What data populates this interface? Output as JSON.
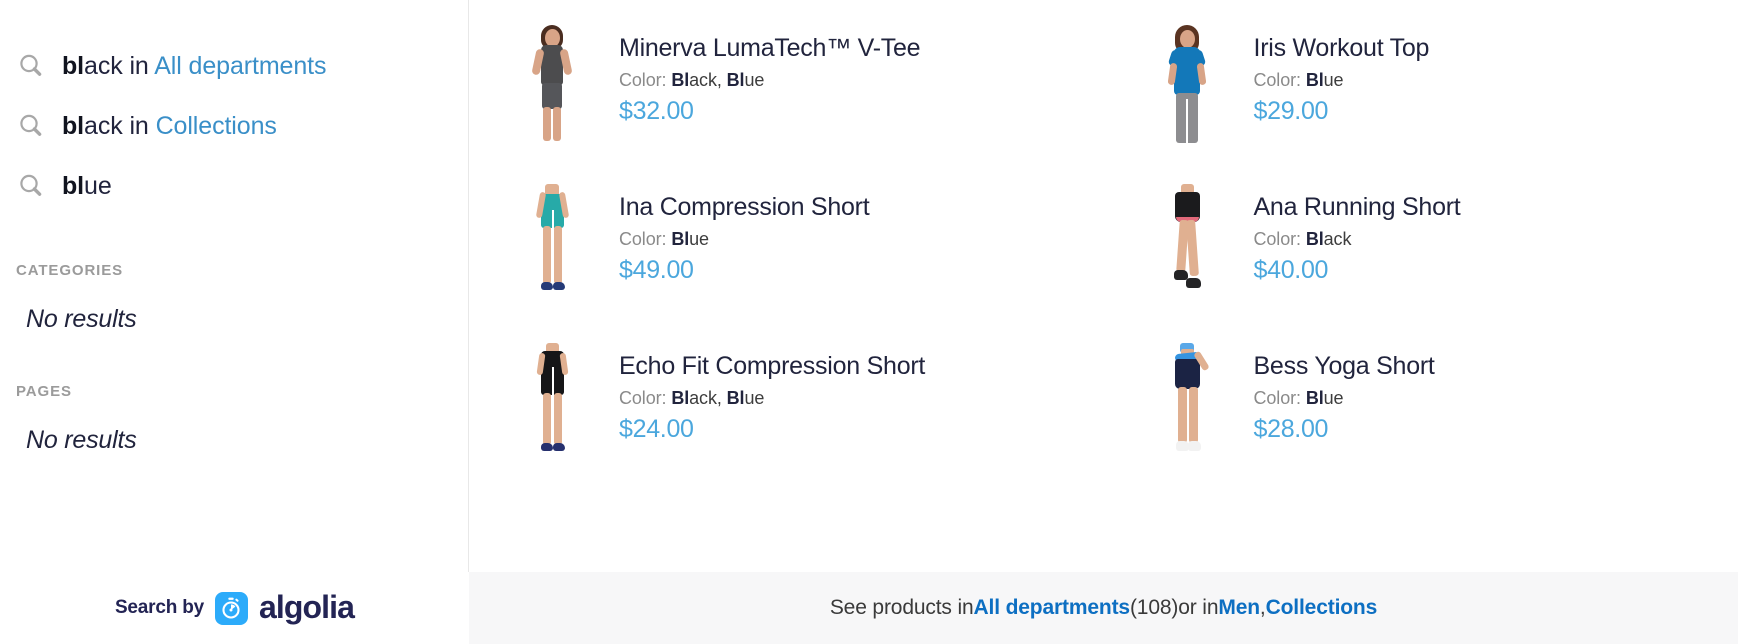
{
  "left": {
    "suggestions": [
      {
        "icon": "search-icon",
        "bold": "bl",
        "rest": "ack in ",
        "scope": "All departments"
      },
      {
        "icon": "search-icon",
        "bold": "bl",
        "rest": "ack in ",
        "scope": "Collections"
      },
      {
        "icon": "search-icon",
        "bold": "bl",
        "rest": "ue",
        "scope": ""
      }
    ],
    "categories": {
      "heading": "CATEGORIES",
      "empty_text": "No results"
    },
    "pages": {
      "heading": "PAGES",
      "empty_text": "No results"
    },
    "branding": {
      "prefix": "Search by",
      "name": "algolia",
      "mark_icon": "algolia-stopwatch-icon",
      "mark_color": "#2cabfa",
      "text_color": "#232454"
    }
  },
  "products": [
    {
      "title": "Minerva LumaTech™ V-Tee",
      "color_label": "Color:",
      "color_bold": "Bl",
      "color_rest": "ack, ",
      "color_bold2": "Bl",
      "color_rest2": "ue",
      "price": "$32.00",
      "image": "woman-dark-gray-vtee-gray-shorts"
    },
    {
      "title": "Iris Workout Top",
      "color_label": "Color:",
      "color_bold": "Bl",
      "color_rest": "ue",
      "color_bold2": "",
      "color_rest2": "",
      "price": "$29.00",
      "image": "woman-blue-top-gray-pants"
    },
    {
      "title": "Ina Compression Short",
      "color_label": "Color:",
      "color_bold": "Bl",
      "color_rest": "ue",
      "color_bold2": "",
      "color_rest2": "",
      "price": "$49.00",
      "image": "teal-compression-short-navy-shoes"
    },
    {
      "title": "Ana Running Short",
      "color_label": "Color:",
      "color_bold": "Bl",
      "color_rest": "ack",
      "color_bold2": "",
      "color_rest2": "",
      "price": "$40.00",
      "image": "black-running-short-coral-trim"
    },
    {
      "title": "Echo Fit Compression Short",
      "color_label": "Color:",
      "color_bold": "Bl",
      "color_rest": "ack, ",
      "color_bold2": "Bl",
      "color_rest2": "ue",
      "price": "$24.00",
      "image": "black-long-compression-short-navy-shoes"
    },
    {
      "title": "Bess Yoga Short",
      "color_label": "Color:",
      "color_bold": "Bl",
      "color_rest": "ue",
      "color_bold2": "",
      "color_rest2": "",
      "price": "$28.00",
      "image": "navy-yoga-short-blue-waistband-white-shoes"
    }
  ],
  "footer": {
    "lead": "See products in ",
    "all_departments": "All departments",
    "count": " (108) ",
    "or_in": "or in ",
    "men": "Men",
    "comma": ", ",
    "collections": "Collections"
  },
  "colors": {
    "link_blue": "#3a8fc8",
    "price_blue": "#4ba7dd",
    "footer_link_blue": "#0d6fc2",
    "muted_gray": "#9b9b9b",
    "text_dark": "#21243d",
    "footer_bg": "#f7f7f8",
    "algolia_blue": "#2cabfa",
    "algolia_navy": "#232454"
  }
}
